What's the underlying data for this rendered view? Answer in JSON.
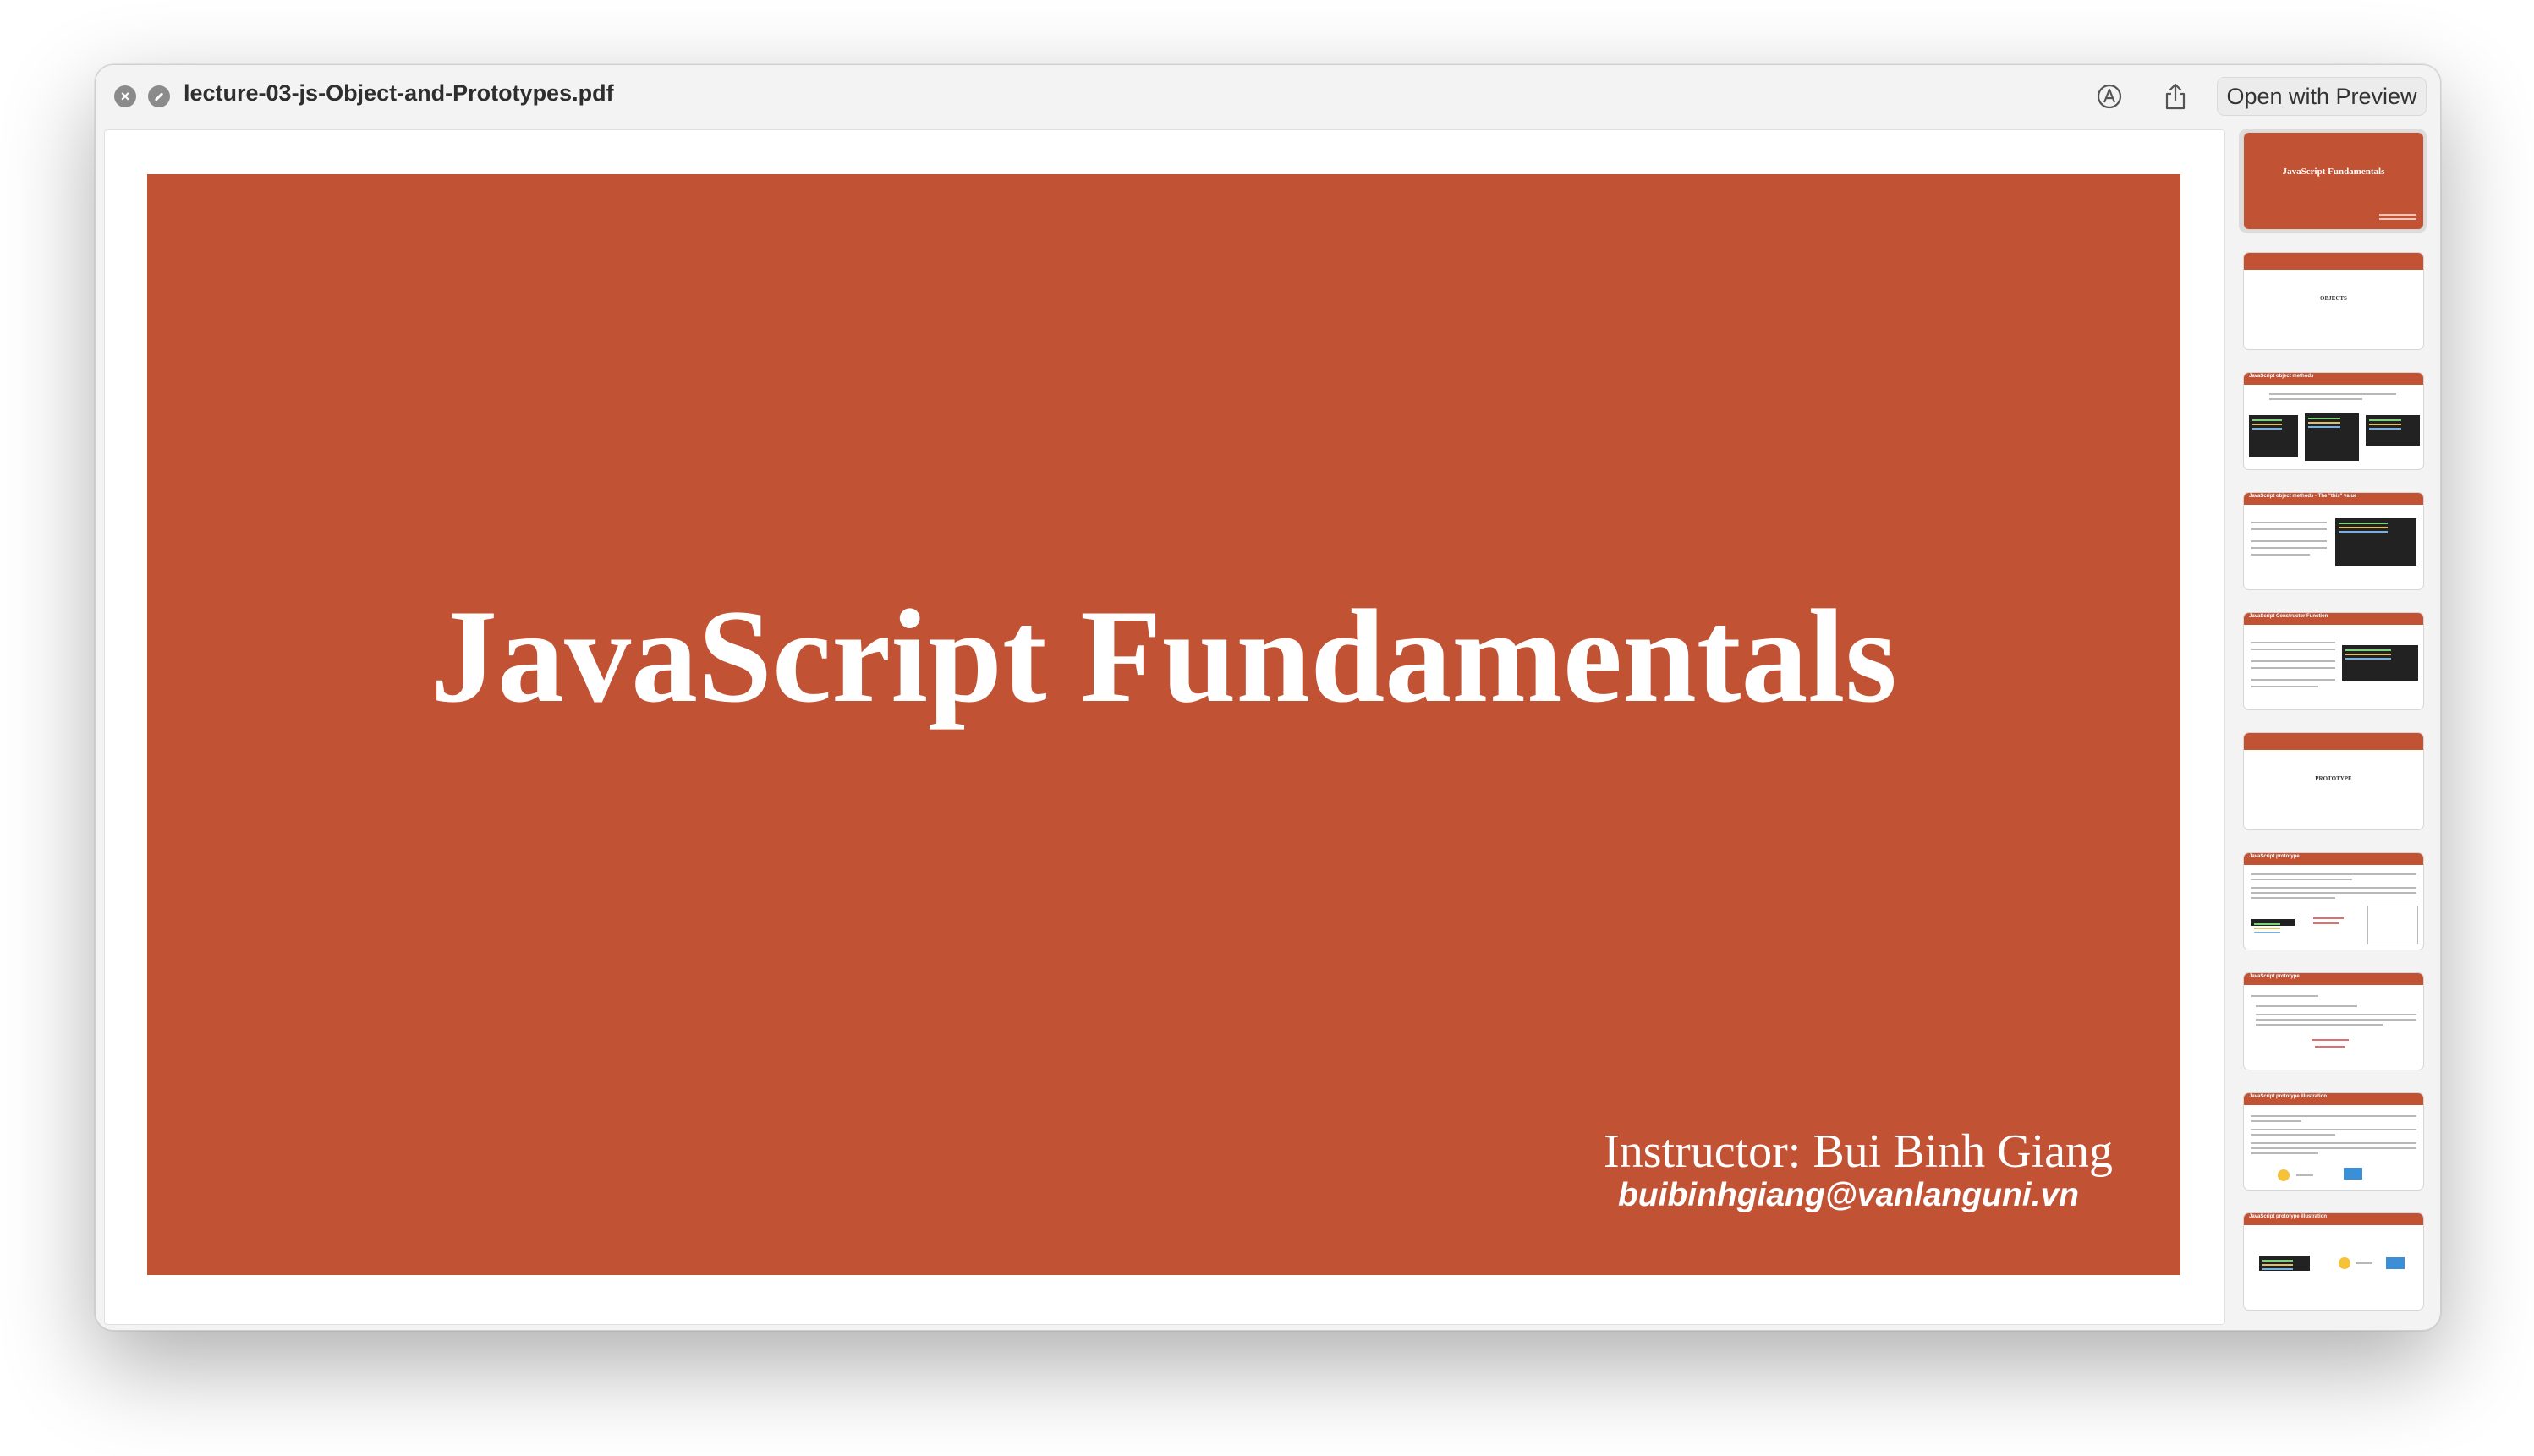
{
  "window": {
    "title": "lecture-03-js-Object-and-Prototypes.pdf",
    "open_with_label": "Open with Preview"
  },
  "slide": {
    "title": "JavaScript Fundamentals",
    "instructor": "Instructor: Bui Binh Giang",
    "email": "buibinhgiang@vanlanguni.vn",
    "background_color": "#c15234"
  },
  "thumbnails": [
    {
      "title": "JavaScript Fundamentals",
      "selected": true
    },
    {
      "title": "OBJECTS"
    },
    {
      "title": "JavaScript object methods"
    },
    {
      "title": "JavaScript object methods - The \"this\" value"
    },
    {
      "title": "JavaScript Constructor Function"
    },
    {
      "title": "PROTOTYPE"
    },
    {
      "title": "JavaScript prototype"
    },
    {
      "title": "JavaScript prototype"
    },
    {
      "title": "JavaScript prototype illustration"
    },
    {
      "title": "JavaScript prototype illustration"
    }
  ],
  "icons": {
    "close": "close-icon",
    "minimize": "fullscreen-icon",
    "markup": "markup-icon",
    "share": "share-icon"
  }
}
